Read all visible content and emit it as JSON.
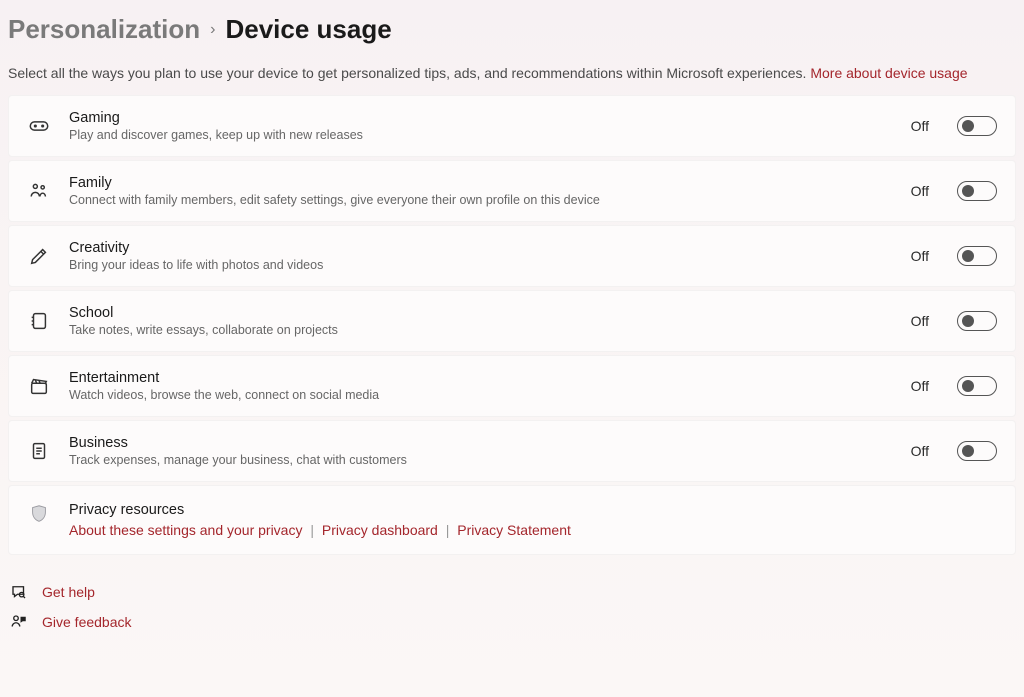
{
  "breadcrumb": {
    "parent": "Personalization",
    "current": "Device usage"
  },
  "subtitle": {
    "text": "Select all the ways you plan to use your device to get personalized tips, ads, and recommendations within Microsoft experiences. ",
    "link_label": "More about device usage"
  },
  "items": [
    {
      "id": "gaming",
      "title": "Gaming",
      "desc": "Play and discover games, keep up with new releases",
      "state_label": "Off"
    },
    {
      "id": "family",
      "title": "Family",
      "desc": "Connect with family members, edit safety settings, give everyone their own profile on this device",
      "state_label": "Off"
    },
    {
      "id": "creativity",
      "title": "Creativity",
      "desc": "Bring your ideas to life with photos and videos",
      "state_label": "Off"
    },
    {
      "id": "school",
      "title": "School",
      "desc": "Take notes, write essays, collaborate on projects",
      "state_label": "Off"
    },
    {
      "id": "entertainment",
      "title": "Entertainment",
      "desc": "Watch videos, browse the web, connect on social media",
      "state_label": "Off"
    },
    {
      "id": "business",
      "title": "Business",
      "desc": "Track expenses, manage your business, chat with customers",
      "state_label": "Off"
    }
  ],
  "privacy": {
    "title": "Privacy resources",
    "links": [
      "About these settings and your privacy",
      "Privacy dashboard",
      "Privacy Statement"
    ]
  },
  "footer": {
    "help": "Get help",
    "feedback": "Give feedback"
  }
}
